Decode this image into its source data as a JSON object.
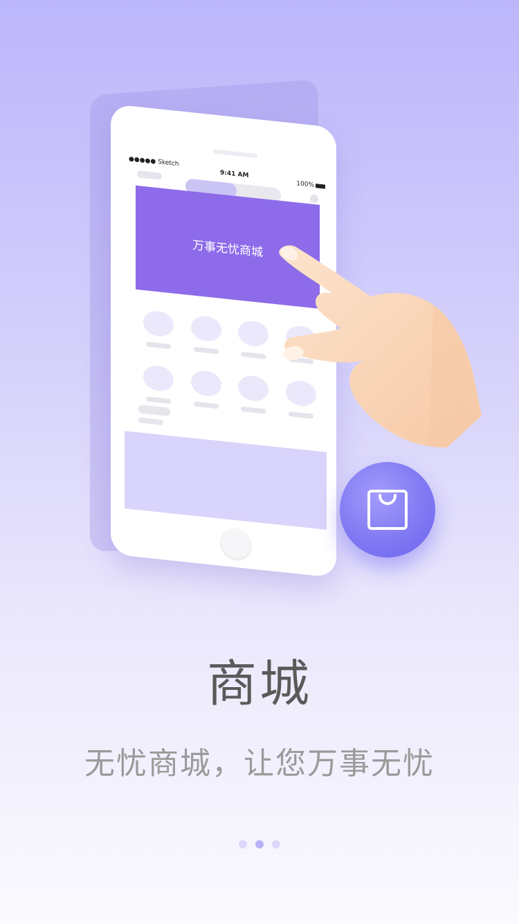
{
  "illustration": {
    "status_bar": {
      "carrier": "●●●●● Sketch",
      "time": "9:41 AM",
      "battery": "100%"
    },
    "banner_text": "万事无忧商城",
    "icon": "shopping-bag-icon"
  },
  "content": {
    "title": "商城",
    "subtitle": "无忧商城，让您万事无忧"
  },
  "pagination": {
    "count": 3,
    "active_index": 1
  },
  "colors": {
    "accent": "#8d6be9",
    "badge": "#8079f3",
    "title": "#5a5a5a",
    "subtitle": "#9a9a9a"
  }
}
